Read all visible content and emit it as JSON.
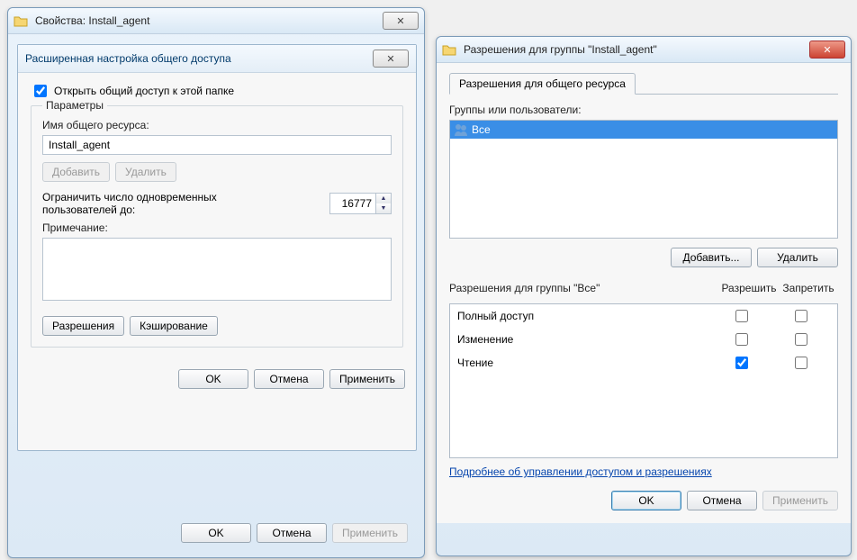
{
  "window1": {
    "title": "Свойства: Install_agent",
    "inner": {
      "title": "Расширенная настройка общего доступа",
      "share_checkbox_label": "Открыть общий доступ к этой папке",
      "share_checked": true,
      "params_legend": "Параметры",
      "share_name_label": "Имя общего ресурса:",
      "share_name_value": "Install_agent",
      "add_btn": "Добавить",
      "remove_btn": "Удалить",
      "limit_label": "Ограничить число одновременных пользователей до:",
      "limit_value": "16777",
      "comment_label": "Примечание:",
      "comment_value": "",
      "permissions_btn": "Разрешения",
      "caching_btn": "Кэширование",
      "ok": "OK",
      "cancel": "Отмена",
      "apply": "Применить"
    },
    "bottom": {
      "ok": "OK",
      "cancel": "Отмена",
      "apply": "Применить"
    }
  },
  "window2": {
    "title": "Разрешения для группы \"Install_agent\"",
    "tab": "Разрешения для общего ресурса",
    "groups_label": "Группы или пользователи:",
    "group_items": [
      "Все"
    ],
    "add_btn": "Добавить...",
    "remove_btn": "Удалить",
    "perm_for_label": "Разрешения для группы \"Все\"",
    "col_allow": "Разрешить",
    "col_deny": "Запретить",
    "perms": [
      {
        "name": "Полный доступ",
        "allow": false,
        "deny": false
      },
      {
        "name": "Изменение",
        "allow": false,
        "deny": false
      },
      {
        "name": "Чтение",
        "allow": true,
        "deny": false
      }
    ],
    "learn_more": "Подробнее об управлении доступом и разрешениях",
    "ok": "OK",
    "cancel": "Отмена",
    "apply": "Применить"
  }
}
